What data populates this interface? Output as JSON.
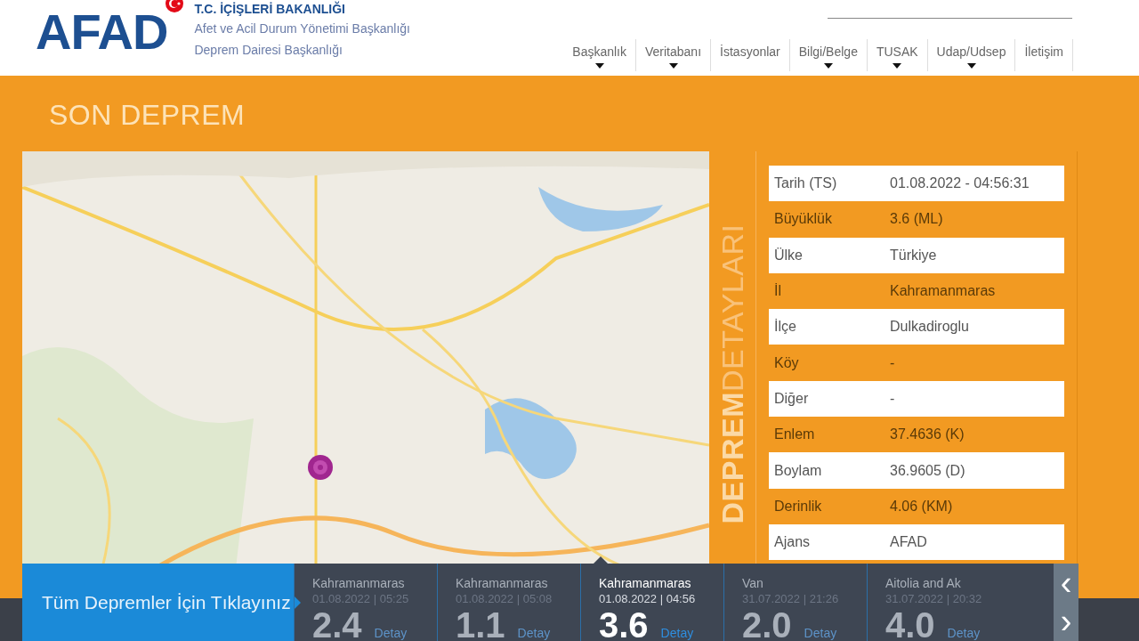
{
  "header": {
    "logo": "AFAD",
    "ministry": "T.C. İÇİŞLERİ BAKANLIĞI",
    "agency": "Afet ve Acil Durum Yönetimi Başkanlığı",
    "department": "Deprem Dairesi Başkanlığı"
  },
  "nav": [
    {
      "label": "Başkanlık",
      "has_menu": true
    },
    {
      "label": "Veritabanı",
      "has_menu": true
    },
    {
      "label": "İstasyonlar",
      "has_menu": false
    },
    {
      "label": "Bilgi/Belge",
      "has_menu": true
    },
    {
      "label": "TUSAK",
      "has_menu": true
    },
    {
      "label": "Udap/Udsep",
      "has_menu": true
    },
    {
      "label": "İletişim",
      "has_menu": false
    }
  ],
  "section_title": "SON DEPREM",
  "details_title": "**DEPREM**DETAYLARI",
  "details": [
    {
      "label": "Tarih (TS)",
      "value": "01.08.2022 - 04:56:31"
    },
    {
      "label": "Büyüklük",
      "value": "3.6 (ML)"
    },
    {
      "label": "Ülke",
      "value": "Türkiye"
    },
    {
      "label": "İl",
      "value": "Kahramanmaras"
    },
    {
      "label": "İlçe",
      "value": "Dulkadiroglu"
    },
    {
      "label": "Köy",
      "value": "-"
    },
    {
      "label": "Diğer",
      "value": "-"
    },
    {
      "label": "Enlem",
      "value": "37.4636 (K)"
    },
    {
      "label": "Boylam",
      "value": "36.9605 (D)"
    },
    {
      "label": "Derinlik",
      "value": "4.06 (KM)"
    },
    {
      "label": "Ajans",
      "value": "AFAD"
    }
  ],
  "all_quakes_link": "Tüm Depremler İçin Tıklayınız",
  "quakes": [
    {
      "place": "Kahramanmaras",
      "time": "01.08.2022 | 05:25",
      "magnitude": "2.4",
      "detail": "Detay",
      "selected": false
    },
    {
      "place": "Kahramanmaras",
      "time": "01.08.2022 | 05:08",
      "magnitude": "1.1",
      "detail": "Detay",
      "selected": false
    },
    {
      "place": "Kahramanmaras",
      "time": "01.08.2022 | 04:56",
      "magnitude": "3.6",
      "detail": "Detay",
      "selected": true
    },
    {
      "place": "Van",
      "time": "31.07.2022 | 21:26",
      "magnitude": "2.0",
      "detail": "Detay",
      "selected": false
    },
    {
      "place": "Aitolia and Ak",
      "time": "31.07.2022 | 20:32",
      "magnitude": "4.0",
      "detail": "Detay",
      "selected": false
    }
  ],
  "pager": {
    "prev": "‹",
    "next": "›"
  }
}
